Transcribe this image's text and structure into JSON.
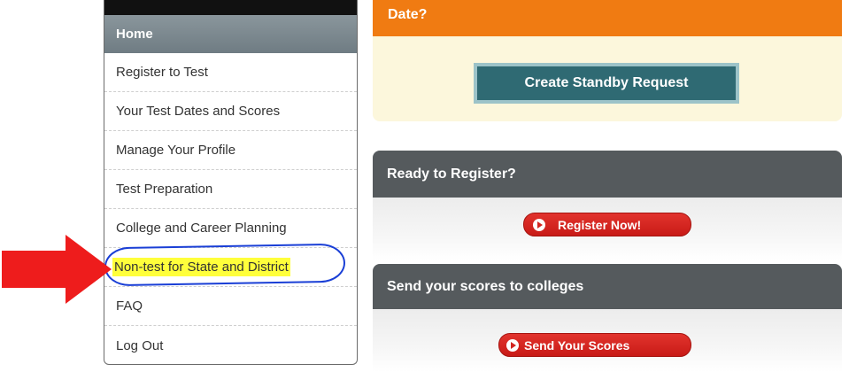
{
  "sidebar": {
    "home_label": "Home",
    "items": [
      {
        "label": "Register to Test"
      },
      {
        "label": "Your Test Dates and Scores"
      },
      {
        "label": "Manage Your Profile"
      },
      {
        "label": "Test Preparation"
      },
      {
        "label": "College and Career Planning"
      },
      {
        "label": "Non-test for State and District"
      },
      {
        "label": "FAQ"
      },
      {
        "label": "Log Out"
      }
    ]
  },
  "standby_panel": {
    "heading": "Date?",
    "button_label": "Create Standby Request"
  },
  "register_panel": {
    "heading": "Ready to Register?",
    "button_label": "Register Now!"
  },
  "scores_panel": {
    "heading": "Send your scores to colleges",
    "button_label": "Send Your Scores"
  },
  "colors": {
    "orange_header": "#f07b12",
    "teal_button": "#2f6a73",
    "red_button": "#d22520",
    "highlight_yellow": "#ffff3b",
    "annotation_blue": "#1a3fd6",
    "arrow_red": "#ee1c1c"
  }
}
